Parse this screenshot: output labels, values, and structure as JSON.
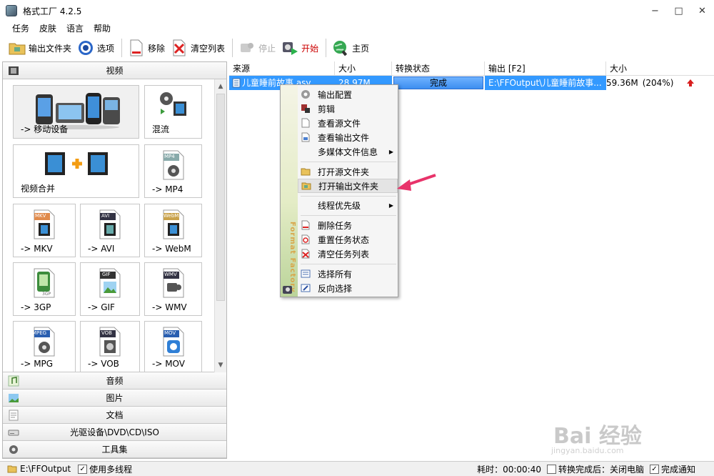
{
  "window": {
    "title": "格式工厂 4.2.5",
    "min": "−",
    "max": "□",
    "close": "✕"
  },
  "menu": [
    "任务",
    "皮肤",
    "语言",
    "帮助"
  ],
  "toolbar": {
    "output_folder": "输出文件夹",
    "options": "选项",
    "remove": "移除",
    "clear_list": "清空列表",
    "stop": "停止",
    "start": "开始",
    "home": "主页"
  },
  "categories": {
    "video": "视频",
    "audio": "音频",
    "picture": "图片",
    "document": "文档",
    "disc": "光驱设备\\DVD\\CD\\ISO",
    "tools": "工具集"
  },
  "tiles": {
    "mobile": "-> 移动设备",
    "mix": "混流",
    "merge": "视频合并",
    "mp4": "-> MP4",
    "mp4_badge": "MP4",
    "mkv": "-> MKV",
    "mkv_badge": "MKV",
    "avi": "-> AVI",
    "avi_badge": "AVI",
    "webm": "-> WebM",
    "webm_badge": "WebM",
    "3gp": "-> 3GP",
    "3gp_badge": "3GP",
    "gif": "-> GIF",
    "gif_badge": "GIF",
    "wmv": "-> WMV",
    "wmv_badge": "WMV",
    "mpg": "-> MPG",
    "mpg_badge": "MPEG",
    "vob": "-> VOB",
    "vob_badge": "VOB",
    "mov": "-> MOV",
    "mov_badge": "MOV"
  },
  "table": {
    "headers": [
      "来源",
      "大小",
      "转换状态",
      "输出 [F2]",
      "大小"
    ],
    "row": {
      "source": "儿童睡前故事.asv",
      "size": "28.97M",
      "status": "完成",
      "output": "E:\\FFOutput\\儿童睡前故事...",
      "out_size": "59.36M",
      "ratio": "(204%)"
    }
  },
  "context_menu": {
    "items": [
      "输出配置",
      "剪辑",
      "查看源文件",
      "查看输出文件",
      "多媒体文件信息",
      "打开源文件夹",
      "打开输出文件夹",
      "线程优先级",
      "删除任务",
      "重置任务状态",
      "清空任务列表",
      "选择所有",
      "反向选择"
    ],
    "brand": "Format Factory"
  },
  "status": {
    "output_path": "E:\\FFOutput",
    "multithread": "使用多线程",
    "elapsed": "耗时：00:00:40",
    "after_done": "转换完成后：关闭电脑",
    "notify": "完成通知",
    "check": "✓"
  },
  "watermark": {
    "main": "Bai 经验",
    "sub": "jingyan.baidu.com"
  },
  "colors": {
    "selection": "#3399ff",
    "arrow": "#e8336a",
    "start": "#cc0000"
  }
}
